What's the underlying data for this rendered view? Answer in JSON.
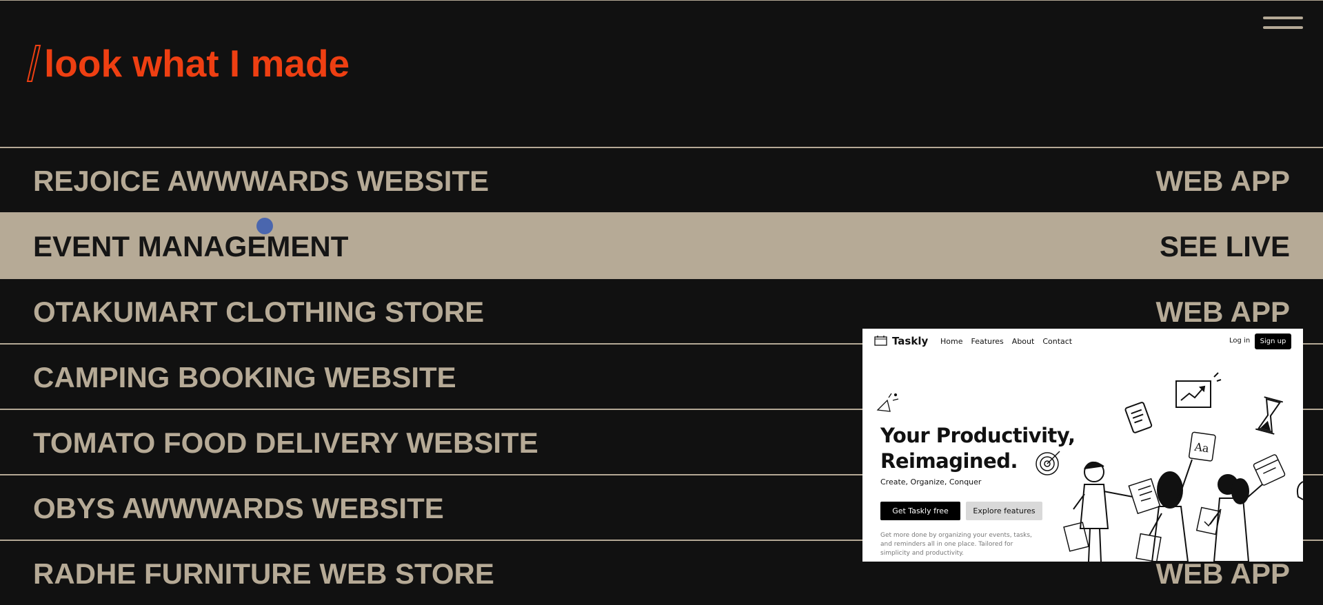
{
  "header": {
    "title": "look what I made",
    "accent_color": "#ee3f12",
    "menu_icon": "hamburger-menu-icon"
  },
  "projects": [
    {
      "name": "REJOICE AWWWARDS WEBSITE",
      "tag": "WEB APP",
      "active": false
    },
    {
      "name": "EVENT MANAGEMENT",
      "tag": "SEE LIVE",
      "active": true
    },
    {
      "name": "OTAKUMART CLOTHING STORE",
      "tag": "WEB APP",
      "active": false
    },
    {
      "name": "CAMPING BOOKING WEBSITE",
      "tag": "",
      "active": false
    },
    {
      "name": "TOMATO FOOD DELIVERY WEBSITE",
      "tag": "",
      "active": false
    },
    {
      "name": "OBYS AWWWARDS WEBSITE",
      "tag": "",
      "active": false
    },
    {
      "name": "RADHE FURNITURE WEB STORE",
      "tag": "WEB APP",
      "active": false
    }
  ],
  "preview": {
    "logo": "Taskly",
    "nav_links": [
      "Home",
      "Features",
      "About",
      "Contact"
    ],
    "login": "Log in",
    "signup": "Sign up",
    "headline_line1": "Your Productivity,",
    "headline_line2": "Reimagined.",
    "subheadline": "Create, Organize, Conquer",
    "cta_primary": "Get Taskly  free",
    "cta_secondary": "Explore features",
    "description": "Get more done by organizing your events, tasks, and reminders all in one place. Tailored for simplicity and productivity."
  },
  "colors": {
    "background": "#111111",
    "text_muted": "#b6aa96",
    "active_row_bg": "#b6aa96",
    "active_row_text": "#151515",
    "cursor_dot": "#4a66ae"
  }
}
